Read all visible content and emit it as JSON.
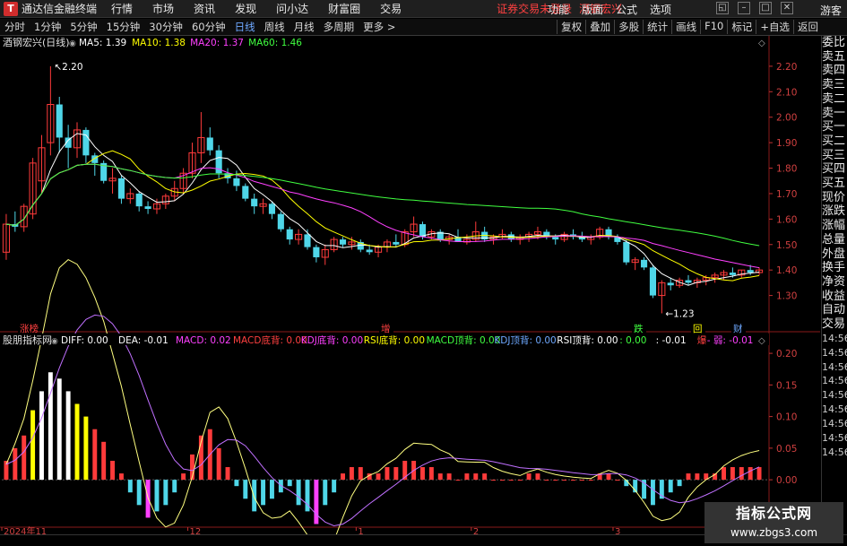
{
  "window": {
    "app_name": "通达信金融终端",
    "menu": [
      "行情",
      "市场",
      "资讯",
      "发现",
      "问小达",
      "财富圈",
      "交易"
    ],
    "notice": "证券交易未登录",
    "stock_tag": "酒钢宏兴",
    "right_menu": [
      "功能",
      "版面",
      "公式",
      "选项"
    ],
    "guest": "游客"
  },
  "toolbar": {
    "periods": [
      "分时",
      "1分钟",
      "5分钟",
      "15分钟",
      "30分钟",
      "60分钟",
      "日线",
      "周线",
      "月线",
      "多周期",
      "更多 >"
    ],
    "active_period": "日线",
    "right_buttons": [
      "复权",
      "叠加",
      "多股",
      "统计",
      "画线",
      "F10",
      "标记",
      "+自选",
      "返回"
    ]
  },
  "main_chart": {
    "title": "酒钢宏兴(日线)",
    "ma_labels": [
      {
        "text": "MA5: 1.39",
        "color": "#ffffff"
      },
      {
        "text": "MA10: 1.38",
        "color": "#ffff00"
      },
      {
        "text": "MA20: 1.37",
        "color": "#ff40ff"
      },
      {
        "text": "MA60: 1.46",
        "color": "#40ff40"
      }
    ],
    "high_label": "2.20",
    "low_label": "1.23",
    "markers": [
      {
        "text": "涨榜",
        "color": "#ff4040"
      },
      {
        "text": "增",
        "color": "#ff4040"
      },
      {
        "text": "跌",
        "color": "#40ff40"
      },
      {
        "text": "回",
        "color": "#ffff00"
      },
      {
        "text": "财",
        "color": "#6ea8ff"
      }
    ]
  },
  "indicator": {
    "title": "股朋指标网",
    "labels": [
      {
        "text": "DIFF: 0.00",
        "color": "#ffffff"
      },
      {
        "text": "DEA: -0.01",
        "color": "#ffffff"
      },
      {
        "text": "MACD: 0.02",
        "color": "#ff40ff"
      },
      {
        "text": "MACD底背: 0.00",
        "color": "#ff4040"
      },
      {
        "text": "KDJ底背: 0.00",
        "color": "#ff40ff"
      },
      {
        "text": "RSI底背: 0.00",
        "color": "#ffff00"
      },
      {
        "text": "MACD顶背: 0.00",
        "color": "#40ff40"
      },
      {
        "text": "KDJ顶背: 0.00",
        "color": "#6ea8ff"
      },
      {
        "text": "RSI顶背: 0.00",
        "color": "#ffffff"
      },
      {
        "text": ": 0.00",
        "color": "#40ff40"
      },
      {
        "text": ": -0.01",
        "color": "#ffffff"
      },
      {
        "text": "爆",
        "color": "#ff4040"
      },
      {
        "text": "- 弱: -0.01",
        "color": "#ff40ff"
      }
    ]
  },
  "side_panel": {
    "items": [
      "委比",
      "卖五",
      "卖四",
      "卖三",
      "卖二",
      "卖一",
      "买一",
      "买二",
      "买三",
      "买四",
      "买五",
      "现价",
      "涨跌",
      "涨幅",
      "总量",
      "外盘",
      "换手",
      "净资",
      "收益"
    ],
    "times": [
      "自动",
      "交易",
      "14:56",
      "14:56",
      "14:56",
      "14:56",
      "14:56",
      "14:56",
      "14:56",
      "14:56",
      "14:56"
    ]
  },
  "watermark": {
    "line1": "指标公式网",
    "line2": "www.zbgs3.com"
  },
  "chart_data": {
    "type": "candlestick",
    "price_axis": {
      "ticks": [
        "2.20",
        "2.10",
        "2.00",
        "1.90",
        "1.80",
        "1.70",
        "1.60",
        "1.50",
        "1.40",
        "1.30"
      ],
      "min": 1.2,
      "max": 2.27
    },
    "indicator_axis": {
      "ticks": [
        "0.20",
        "0.15",
        "0.10",
        "0.05",
        "0.00",
        "-0.05"
      ],
      "min": -0.075,
      "max": 0.22
    },
    "date_ticks": [
      {
        "label": "2024年11",
        "index": 0
      },
      {
        "label": "12",
        "index": 21
      },
      {
        "label": "1",
        "index": 40
      },
      {
        "label": "2",
        "index": 53
      },
      {
        "label": "3",
        "index": 69
      },
      {
        "label": "4",
        "index": 85
      }
    ],
    "candles": [
      [
        1.47,
        1.62,
        1.44,
        1.58
      ],
      [
        1.58,
        1.63,
        1.55,
        1.57
      ],
      [
        1.57,
        1.66,
        1.55,
        1.65
      ],
      [
        1.62,
        1.84,
        1.6,
        1.82
      ],
      [
        1.75,
        1.93,
        1.7,
        1.88
      ],
      [
        1.9,
        2.2,
        1.85,
        2.05
      ],
      [
        2.05,
        2.08,
        1.86,
        1.92
      ],
      [
        1.92,
        1.97,
        1.8,
        1.88
      ],
      [
        1.88,
        1.98,
        1.84,
        1.95
      ],
      [
        1.95,
        1.96,
        1.82,
        1.85
      ],
      [
        1.85,
        1.86,
        1.77,
        1.82
      ],
      [
        1.82,
        1.83,
        1.74,
        1.75
      ],
      [
        1.75,
        1.8,
        1.7,
        1.76
      ],
      [
        1.76,
        1.77,
        1.66,
        1.68
      ],
      [
        1.68,
        1.72,
        1.66,
        1.7
      ],
      [
        1.7,
        1.71,
        1.63,
        1.65
      ],
      [
        1.65,
        1.67,
        1.62,
        1.64
      ],
      [
        1.64,
        1.68,
        1.62,
        1.66
      ],
      [
        1.66,
        1.7,
        1.64,
        1.69
      ],
      [
        1.69,
        1.75,
        1.67,
        1.72
      ],
      [
        1.72,
        1.8,
        1.7,
        1.78
      ],
      [
        1.78,
        1.9,
        1.76,
        1.86
      ],
      [
        1.86,
        2.02,
        1.82,
        1.92
      ],
      [
        1.92,
        1.96,
        1.85,
        1.87
      ],
      [
        1.87,
        1.89,
        1.76,
        1.78
      ],
      [
        1.78,
        1.8,
        1.74,
        1.76
      ],
      [
        1.76,
        1.79,
        1.71,
        1.73
      ],
      [
        1.73,
        1.74,
        1.67,
        1.68
      ],
      [
        1.68,
        1.7,
        1.62,
        1.65
      ],
      [
        1.65,
        1.68,
        1.62,
        1.66
      ],
      [
        1.66,
        1.67,
        1.6,
        1.62
      ],
      [
        1.62,
        1.63,
        1.55,
        1.56
      ],
      [
        1.56,
        1.57,
        1.5,
        1.52
      ],
      [
        1.52,
        1.56,
        1.5,
        1.54
      ],
      [
        1.54,
        1.56,
        1.48,
        1.49
      ],
      [
        1.49,
        1.5,
        1.43,
        1.45
      ],
      [
        1.45,
        1.5,
        1.42,
        1.48
      ],
      [
        1.48,
        1.53,
        1.47,
        1.52
      ],
      [
        1.52,
        1.53,
        1.49,
        1.5
      ],
      [
        1.5,
        1.53,
        1.48,
        1.51
      ],
      [
        1.51,
        1.52,
        1.47,
        1.48
      ],
      [
        1.48,
        1.5,
        1.46,
        1.47
      ],
      [
        1.47,
        1.5,
        1.45,
        1.49
      ],
      [
        1.49,
        1.52,
        1.47,
        1.51
      ],
      [
        1.51,
        1.54,
        1.49,
        1.5
      ],
      [
        1.5,
        1.56,
        1.49,
        1.55
      ],
      [
        1.55,
        1.61,
        1.53,
        1.58
      ],
      [
        1.58,
        1.59,
        1.52,
        1.53
      ],
      [
        1.53,
        1.56,
        1.52,
        1.55
      ],
      [
        1.55,
        1.56,
        1.51,
        1.52
      ],
      [
        1.52,
        1.54,
        1.5,
        1.53
      ],
      [
        1.53,
        1.56,
        1.52,
        1.51
      ],
      [
        1.51,
        1.54,
        1.5,
        1.52
      ],
      [
        1.52,
        1.59,
        1.51,
        1.55
      ],
      [
        1.55,
        1.57,
        1.51,
        1.52
      ],
      [
        1.52,
        1.54,
        1.5,
        1.53
      ],
      [
        1.53,
        1.56,
        1.52,
        1.54
      ],
      [
        1.54,
        1.55,
        1.51,
        1.52
      ],
      [
        1.52,
        1.54,
        1.5,
        1.53
      ],
      [
        1.53,
        1.55,
        1.51,
        1.54
      ],
      [
        1.54,
        1.57,
        1.52,
        1.55
      ],
      [
        1.55,
        1.56,
        1.52,
        1.53
      ],
      [
        1.53,
        1.54,
        1.5,
        1.52
      ],
      [
        1.52,
        1.55,
        1.51,
        1.54
      ],
      [
        1.54,
        1.56,
        1.52,
        1.53
      ],
      [
        1.53,
        1.55,
        1.51,
        1.52
      ],
      [
        1.52,
        1.54,
        1.5,
        1.53
      ],
      [
        1.53,
        1.57,
        1.52,
        1.56
      ],
      [
        1.56,
        1.57,
        1.52,
        1.53
      ],
      [
        1.53,
        1.54,
        1.5,
        1.51
      ],
      [
        1.51,
        1.52,
        1.42,
        1.43
      ],
      [
        1.43,
        1.45,
        1.4,
        1.44
      ],
      [
        1.44,
        1.45,
        1.4,
        1.41
      ],
      [
        1.41,
        1.42,
        1.29,
        1.3
      ],
      [
        1.3,
        1.36,
        1.23,
        1.35
      ],
      [
        1.35,
        1.37,
        1.32,
        1.34
      ],
      [
        1.34,
        1.37,
        1.33,
        1.36
      ],
      [
        1.36,
        1.38,
        1.34,
        1.35
      ],
      [
        1.35,
        1.37,
        1.33,
        1.36
      ],
      [
        1.36,
        1.38,
        1.34,
        1.37
      ],
      [
        1.37,
        1.39,
        1.35,
        1.38
      ],
      [
        1.38,
        1.4,
        1.36,
        1.39
      ],
      [
        1.39,
        1.41,
        1.37,
        1.38
      ],
      [
        1.38,
        1.4,
        1.37,
        1.4
      ],
      [
        1.4,
        1.42,
        1.38,
        1.39
      ],
      [
        1.39,
        1.41,
        1.38,
        1.4
      ]
    ],
    "macd_bars": [
      0.03,
      0.05,
      0.07,
      0.11,
      0.14,
      0.17,
      0.16,
      0.14,
      0.12,
      0.1,
      0.08,
      0.06,
      0.03,
      0.01,
      -0.02,
      -0.04,
      -0.06,
      -0.05,
      -0.04,
      -0.02,
      0.01,
      0.04,
      0.07,
      0.08,
      0.05,
      0.02,
      -0.01,
      -0.03,
      -0.05,
      -0.04,
      -0.03,
      -0.02,
      -0.01,
      -0.04,
      -0.05,
      -0.07,
      -0.04,
      -0.02,
      0.01,
      0.02,
      0.02,
      0.01,
      0.01,
      0.02,
      0.02,
      0.03,
      0.03,
      0.02,
      0.02,
      0.01,
      0.01,
      0.0,
      0.01,
      0.01,
      0.01,
      0.0,
      0.0,
      0.0,
      0.0,
      0.01,
      0.01,
      0.0,
      0.0,
      0.0,
      0.0,
      0.0,
      0.0,
      0.01,
      0.01,
      0.0,
      -0.01,
      -0.02,
      -0.03,
      -0.04,
      -0.03,
      -0.02,
      -0.01,
      0.01,
      0.01,
      0.01,
      0.01,
      0.02,
      0.02,
      0.02,
      0.02,
      0.02
    ]
  }
}
